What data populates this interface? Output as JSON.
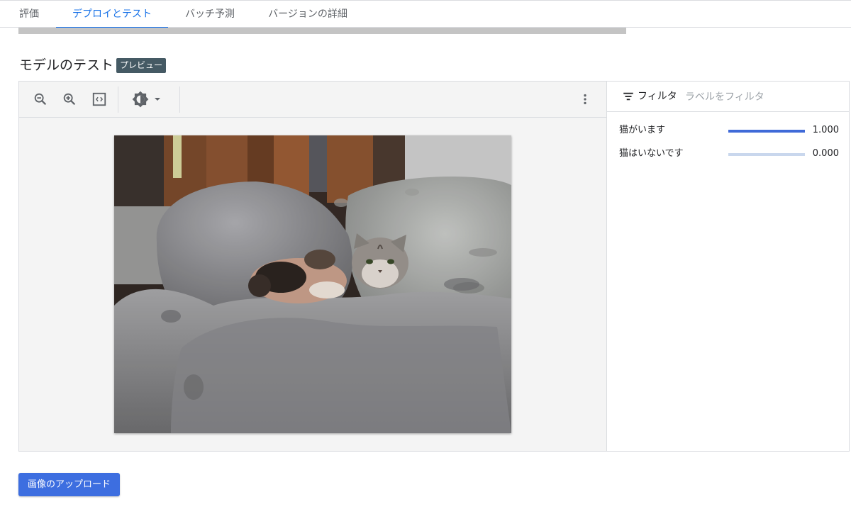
{
  "tabs": [
    {
      "label": "評価"
    },
    {
      "label": "デプロイとテスト",
      "active": true
    },
    {
      "label": "バッチ予測"
    },
    {
      "label": "バージョンの詳細"
    }
  ],
  "section": {
    "title": "モデルのテスト",
    "badge": "プレビュー"
  },
  "toolbar": {
    "icons": [
      "zoom-out-icon",
      "zoom-in-icon",
      "fit-to-screen-icon",
      "brightness-icon",
      "more-vert-icon"
    ]
  },
  "filter": {
    "label": "フィルタ",
    "placeholder": "ラベルをフィルタ"
  },
  "predictions": [
    {
      "label": "猫がいます",
      "score": 1.0,
      "score_text": "1.000"
    },
    {
      "label": "猫はいないです",
      "score": 0.0,
      "score_text": "0.000"
    }
  ],
  "upload_button": "画像のアップロード",
  "colors": {
    "accent": "#1a73e8",
    "button": "#3d6ee0",
    "badge_bg": "#455a64",
    "bar_fill": "#3f6ad8",
    "bar_track": "#c9d7ed"
  }
}
